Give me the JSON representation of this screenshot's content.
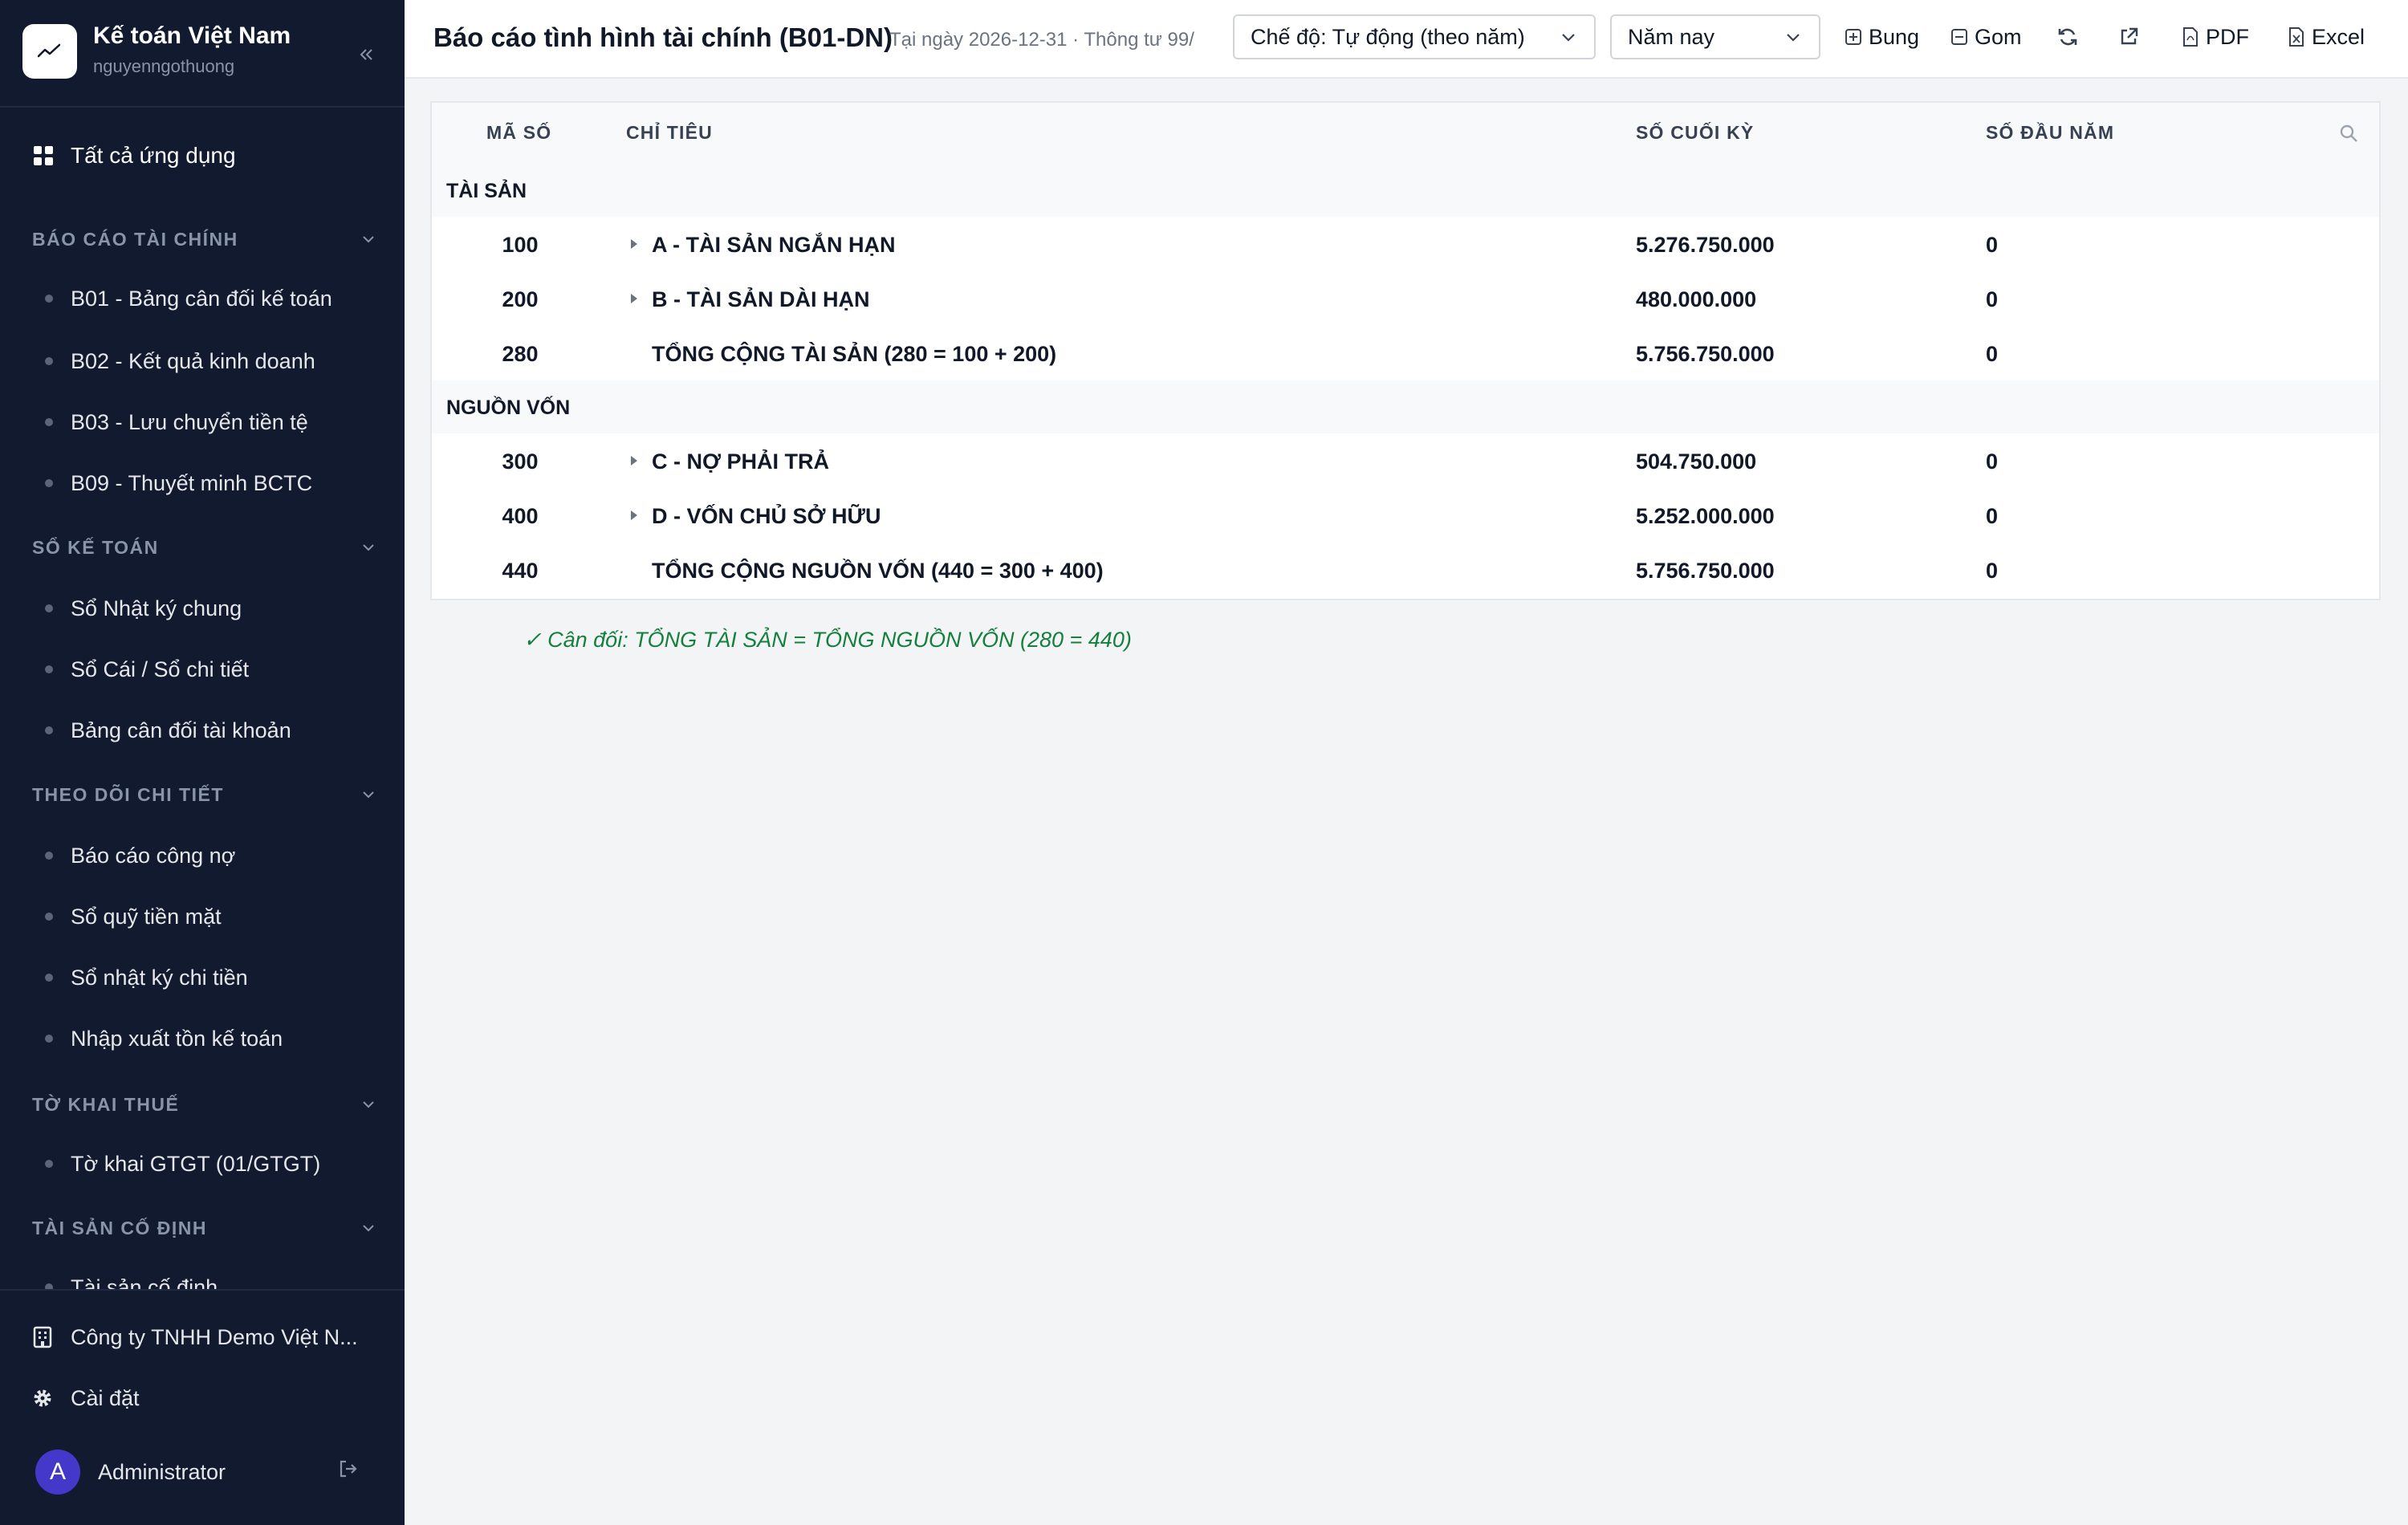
{
  "sidebar": {
    "app_title": "Kế toán Việt Nam",
    "username": "nguyenngothuong",
    "all_apps_label": "Tất cả ứng dụng",
    "sections": [
      {
        "title": "BÁO CÁO TÀI CHÍNH",
        "items": [
          "B01 - Bảng cân đối kế toán",
          "B02 - Kết quả kinh doanh",
          "B03 - Lưu chuyển tiền tệ",
          "B09 - Thuyết minh BCTC"
        ]
      },
      {
        "title": "SỔ KẾ TOÁN",
        "items": [
          "Sổ Nhật ký chung",
          "Sổ Cái / Sổ chi tiết",
          "Bảng cân đối tài khoản"
        ]
      },
      {
        "title": "THEO DÕI CHI TIẾT",
        "items": [
          "Báo cáo công nợ",
          "Sổ quỹ tiền mặt",
          "Sổ nhật ký chi tiền",
          "Nhập xuất tồn kế toán"
        ]
      },
      {
        "title": "TỜ KHAI THUẾ",
        "items": [
          "Tờ khai GTGT (01/GTGT)"
        ]
      },
      {
        "title": "TÀI SẢN CỐ ĐỊNH",
        "items": [
          "Tài sản cố định"
        ]
      }
    ],
    "company": "Công ty TNHH Demo Việt N...",
    "settings_label": "Cài đặt",
    "user_initial": "A",
    "user_name": "Administrator"
  },
  "header": {
    "title": "Báo cáo tình hình tài chính (B01-DN)",
    "subtitle": "Tại ngày 2026-12-31 · Thông tư 99/",
    "mode_select": "Chế độ: Tự động (theo năm)",
    "period_select": "Năm nay",
    "expand_label": "Bung",
    "collapse_label": "Gom",
    "pdf_label": "PDF",
    "excel_label": "Excel"
  },
  "table": {
    "columns": {
      "code": "MÃ SỐ",
      "name": "CHỈ TIÊU",
      "end": "SỐ CUỐI KỲ",
      "start": "SỐ ĐẦU NĂM"
    },
    "groups": [
      {
        "label": "TÀI SẢN",
        "rows": [
          {
            "code": "100",
            "name": "A - TÀI SẢN NGẮN HẠN",
            "end": "5.276.750.000",
            "start": "0",
            "expandable": true
          },
          {
            "code": "200",
            "name": "B - TÀI SẢN DÀI HẠN",
            "end": "480.000.000",
            "start": "0",
            "expandable": true
          },
          {
            "code": "280",
            "name": "TỔNG CỘNG TÀI SẢN (280 = 100 + 200)",
            "end": "5.756.750.000",
            "start": "0",
            "expandable": false
          }
        ]
      },
      {
        "label": "NGUỒN VỐN",
        "rows": [
          {
            "code": "300",
            "name": "C - NỢ PHẢI TRẢ",
            "end": "504.750.000",
            "start": "0",
            "expandable": true
          },
          {
            "code": "400",
            "name": "D - VỐN CHỦ SỞ HỮU",
            "end": "5.252.000.000",
            "start": "0",
            "expandable": true
          },
          {
            "code": "440",
            "name": "TỔNG CỘNG NGUỒN VỐN (440 = 300 + 400)",
            "end": "5.756.750.000",
            "start": "0",
            "expandable": false
          }
        ]
      }
    ]
  },
  "balance_note": "✓ Cân đối: TỔNG TÀI SẢN = TỔNG NGUỒN VỐN (280 = 440)",
  "colors": {
    "sidebar_bg": "#111a2e",
    "success": "#15803d",
    "avatar": "#4338ca"
  }
}
